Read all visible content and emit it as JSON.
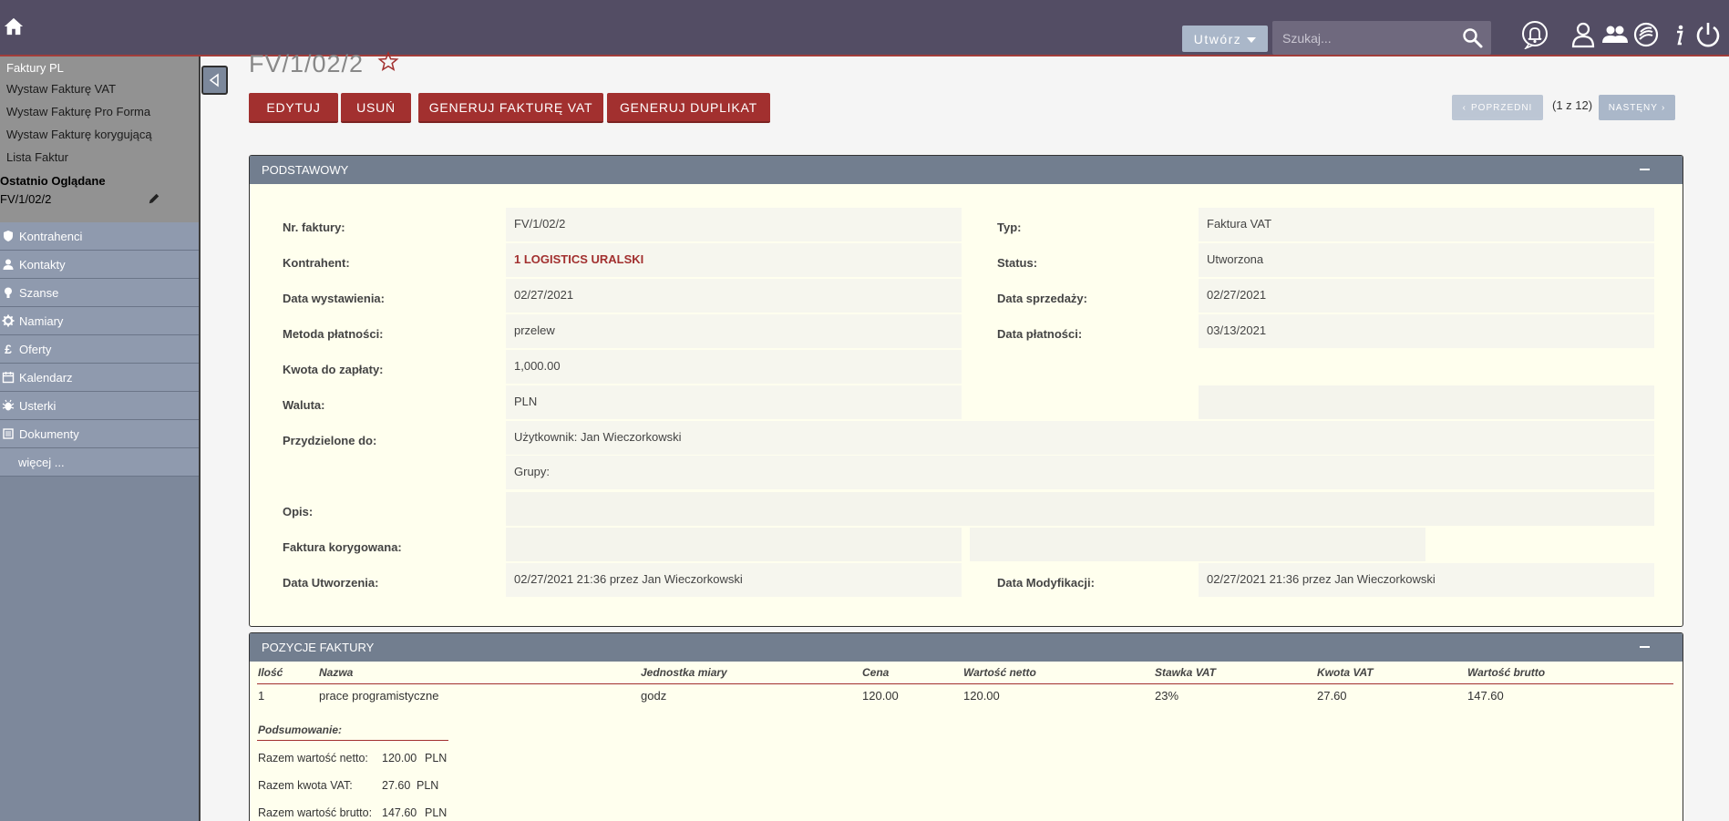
{
  "header": {
    "create_label": "Utwórz",
    "search_placeholder": "Szukaj..."
  },
  "sidebar": {
    "section_title": "Faktury PL",
    "actions": [
      "Wystaw Fakturę VAT",
      "Wystaw Fakturę Pro Forma",
      "Wystaw Fakturę korygującą",
      "Lista Faktur"
    ],
    "recently_viewed_title": "Ostatnio Oglądane",
    "recent_item": "FV/1/02/2",
    "modules": [
      {
        "label": "Kontrahenci",
        "icon": "shield-icon"
      },
      {
        "label": "Kontakty",
        "icon": "person-icon"
      },
      {
        "label": "Szanse",
        "icon": "lightbulb-icon"
      },
      {
        "label": "Namiary",
        "icon": "gear-icon"
      },
      {
        "label": "Oferty",
        "icon": "pound-icon"
      },
      {
        "label": "Kalendarz",
        "icon": "calendar-icon"
      },
      {
        "label": "Usterki",
        "icon": "bug-icon"
      },
      {
        "label": "Dokumenty",
        "icon": "documents-icon"
      }
    ],
    "more_label": "więcej ..."
  },
  "record": {
    "title": "FV/1/02/2"
  },
  "actions": {
    "edit": "EDYTUJ",
    "delete": "USUŃ",
    "generate_vat": "GENERUJ FAKTURĘ VAT",
    "generate_duplicate": "GENERUJ DUPLIKAT"
  },
  "pagination": {
    "prev": "POPRZEDNI",
    "count": "(1 z 12)",
    "next": "NASTĘNY"
  },
  "basic_panel": {
    "title": "PODSTAWOWY",
    "fields": {
      "invoice_no_label": "Nr. faktury:",
      "invoice_no": "FV/1/02/2",
      "type_label": "Typ:",
      "type": "Faktura VAT",
      "contractor_label": "Kontrahent:",
      "contractor": "1 LOGISTICS URALSKI",
      "status_label": "Status:",
      "status": "Utworzona",
      "issue_date_label": "Data wystawienia:",
      "issue_date": "02/27/2021",
      "sale_date_label": "Data sprzedaży:",
      "sale_date": "02/27/2021",
      "payment_method_label": "Metoda płatności:",
      "payment_method": "przelew",
      "payment_date_label": "Data płatności:",
      "payment_date": "03/13/2021",
      "amount_label": "Kwota do zapłaty:",
      "amount": "1,000.00",
      "currency_label": "Waluta:",
      "currency": "PLN",
      "assigned_label": "Przydzielone do:",
      "assigned_user": "Użytkownik: Jan Wieczorkowski",
      "assigned_groups": "Grupy:",
      "description_label": "Opis:",
      "corrected_label": "Faktura korygowana:",
      "created_label": "Data Utworzenia:",
      "created": "02/27/2021 21:36 przez Jan Wieczorkowski",
      "modified_label": "Data Modyfikacji:",
      "modified": "02/27/2021 21:36 przez Jan Wieczorkowski"
    }
  },
  "items_panel": {
    "title": "POZYCJE FAKTURY",
    "columns": [
      "Ilość",
      "Nazwa",
      "Jednostka miary",
      "Cena",
      "Wartość netto",
      "Stawka VAT",
      "Kwota VAT",
      "Wartość brutto"
    ],
    "rows": [
      [
        "1",
        "prace programistyczne",
        "godz",
        "120.00",
        "120.00",
        "23%",
        "27.60",
        "147.60"
      ]
    ],
    "summary_title": "Podsumowanie:",
    "summary": [
      {
        "label": "Razem wartość netto:",
        "value": "120.00",
        "currency": "PLN"
      },
      {
        "label": "Razem kwota VAT:",
        "value": "27.60",
        "currency": "PLN"
      },
      {
        "label": "Razem wartość brutto:",
        "value": "147.60",
        "currency": "PLN"
      }
    ]
  },
  "colors": {
    "topbar": "#534d64",
    "accent": "#a2302f",
    "sidebar": "#7d889b",
    "panel_header": "#727e8f",
    "panel_bg": "#ffffee"
  }
}
